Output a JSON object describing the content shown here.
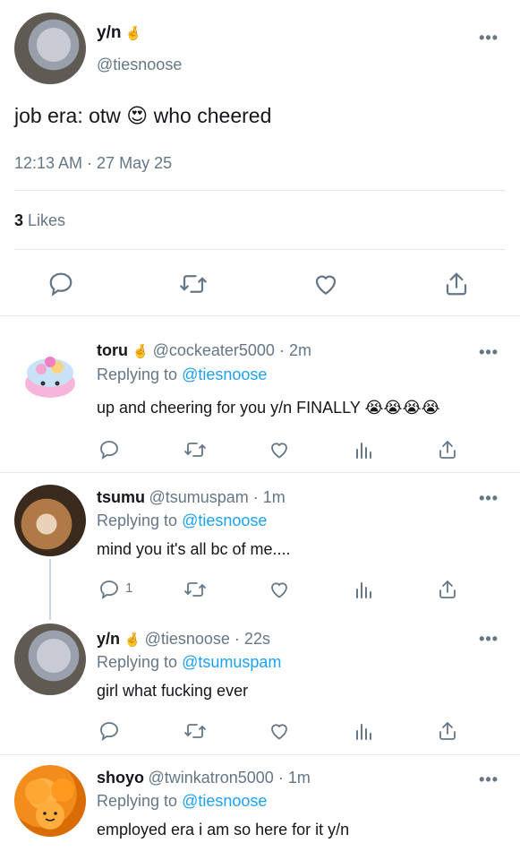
{
  "main_tweet": {
    "name": "y/n",
    "badge": "🤞",
    "handle": "@tiesnoose",
    "text": "job era: otw 😍 who cheered",
    "timestamp": "12:13 AM · 27 May 25",
    "likes_count": "3",
    "likes_label": "Likes",
    "more": "•••"
  },
  "replies": [
    {
      "name": "toru",
      "badge": "🤞",
      "handle": "@cockeater5000 · 2m",
      "replying_prefix": "Replying to",
      "replying_to": "@tiesnoose",
      "text": "up and cheering for you y/n FINALLY 😭😭😭😭",
      "reply_count": "",
      "more": "•••"
    },
    {
      "name": "tsumu",
      "badge": "",
      "handle": "@tsumuspam · 1m",
      "replying_prefix": "Replying to",
      "replying_to": "@tiesnoose",
      "text": "mind you it's all bc of me....",
      "reply_count": "1",
      "more": "•••"
    },
    {
      "name": "y/n",
      "badge": "🤞",
      "handle": "@tiesnoose · 22s",
      "replying_prefix": "Replying to",
      "replying_to": "@tsumuspam",
      "text": "girl what fucking ever",
      "reply_count": "",
      "more": "•••"
    },
    {
      "name": "shoyo",
      "badge": "",
      "handle": "@twinkatron5000 · 1m",
      "replying_prefix": "Replying to",
      "replying_to": "@tiesnoose",
      "text": "employed era i am so here for it y/n",
      "reply_count": "",
      "more": "•••"
    }
  ],
  "icons": {
    "reply": "reply-icon",
    "retweet": "retweet-icon",
    "like": "heart-icon",
    "analytics": "analytics-icon",
    "share": "share-icon"
  },
  "colors": {
    "link_blue": "#1da1f2",
    "secondary_grey": "#657786",
    "divider": "#e1e8ed"
  }
}
